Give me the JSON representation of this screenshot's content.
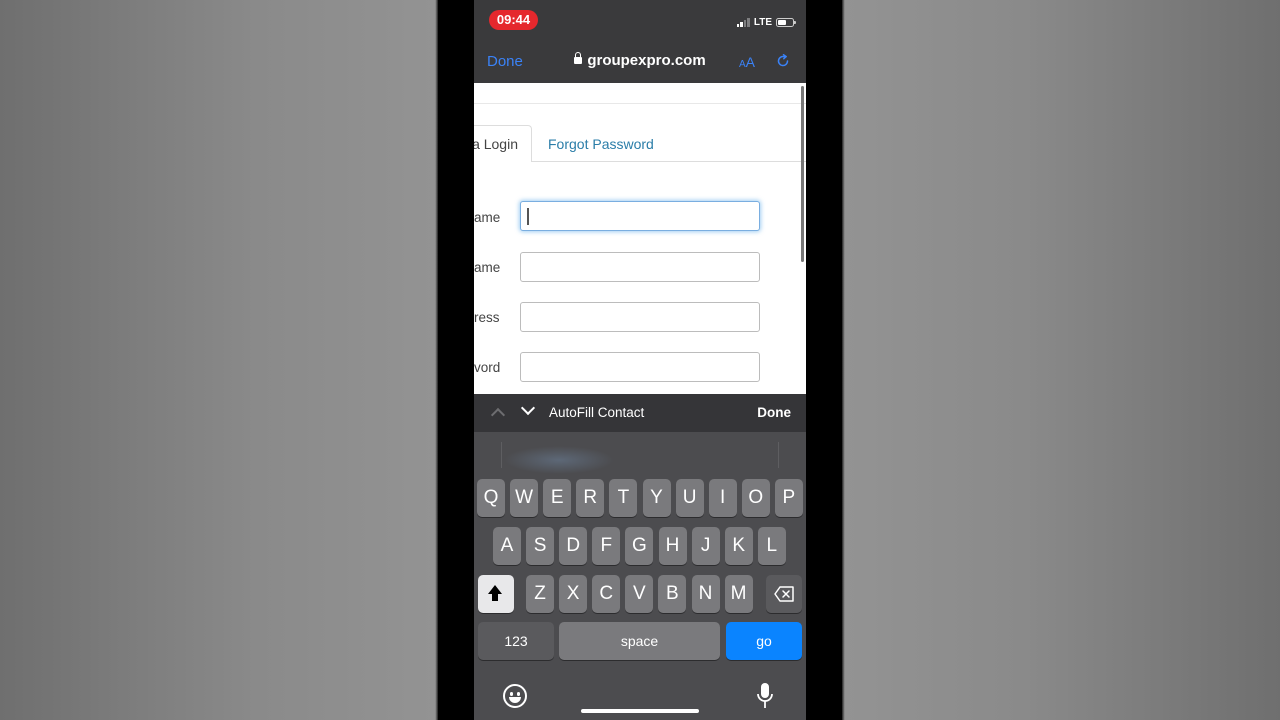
{
  "status_bar": {
    "time": "09:44",
    "network": "LTE"
  },
  "browser": {
    "done_label": "Done",
    "url": "groupexpro.com",
    "text_size_label_small": "A",
    "text_size_label_large": "A"
  },
  "page": {
    "tabs": [
      {
        "label": "a Login"
      },
      {
        "label": "Forgot Password"
      }
    ],
    "fields": [
      {
        "label": "ame",
        "value": ""
      },
      {
        "label": "ame",
        "value": ""
      },
      {
        "label": "ress",
        "value": ""
      },
      {
        "label": "vord",
        "value": ""
      }
    ]
  },
  "accessory_bar": {
    "autofill_label": "AutoFill Contact",
    "done_label": "Done"
  },
  "keyboard": {
    "row1": [
      "Q",
      "W",
      "E",
      "R",
      "T",
      "Y",
      "U",
      "I",
      "O",
      "P"
    ],
    "row2": [
      "A",
      "S",
      "D",
      "F",
      "G",
      "H",
      "J",
      "K",
      "L"
    ],
    "row3": [
      "Z",
      "X",
      "C",
      "V",
      "B",
      "N",
      "M"
    ],
    "numbers_label": "123",
    "space_label": "space",
    "go_label": "go"
  },
  "colors": {
    "accent": "#0a84ff",
    "link": "#2a7da8",
    "time_pill": "#e5282d"
  }
}
